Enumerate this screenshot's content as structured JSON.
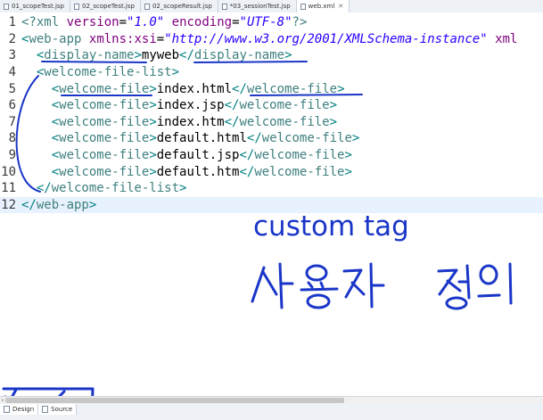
{
  "tabs": [
    {
      "label": "01_scopeTest.jsp"
    },
    {
      "label": "02_scopeTest.jsp"
    },
    {
      "label": "02_scopeResult.jsp"
    },
    {
      "label": "*03_sessionTest.jsp"
    },
    {
      "label": "web.xml",
      "active": true
    }
  ],
  "editor": {
    "lines": [
      {
        "num": "1"
      },
      {
        "num": "2"
      },
      {
        "num": "3"
      },
      {
        "num": "4"
      },
      {
        "num": "5"
      },
      {
        "num": "6"
      },
      {
        "num": "7"
      },
      {
        "num": "8"
      },
      {
        "num": "9"
      },
      {
        "num": "10"
      },
      {
        "num": "11"
      },
      {
        "num": "12"
      }
    ],
    "l1": {
      "open": "<?",
      "name": "xml",
      "a1": "version",
      "v1": "\"1.0\"",
      "a2": "encoding",
      "v2": "\"UTF-8\"",
      "close": "?>"
    },
    "l2": {
      "open": "<",
      "name": "web-app",
      "a1": "xmlns:xsi",
      "v1": "\"http://www.w3.org/2001/XMLSchema-instance\"",
      "tail": "xml"
    },
    "l3": {
      "tag": "display-name",
      "text": "myweb"
    },
    "l4": {
      "tag": "welcome-file-list"
    },
    "files": [
      "index.html",
      "index.jsp",
      "index.htm",
      "default.html",
      "default.jsp",
      "default.htm"
    ],
    "file_tag": "welcome-file",
    "l12": {
      "tag": "web-app"
    }
  },
  "annotations": {
    "custom_tag": "custom tag",
    "korean": "사용자 정의"
  },
  "bottom_tabs": [
    {
      "label": "Design"
    },
    {
      "label": "Source"
    }
  ],
  "colors": {
    "ink": "#1a36c8",
    "tag": "#3f7f7f",
    "attr": "#7f007f",
    "value": "#2a00ff",
    "current_line": "#e8f2fe"
  }
}
